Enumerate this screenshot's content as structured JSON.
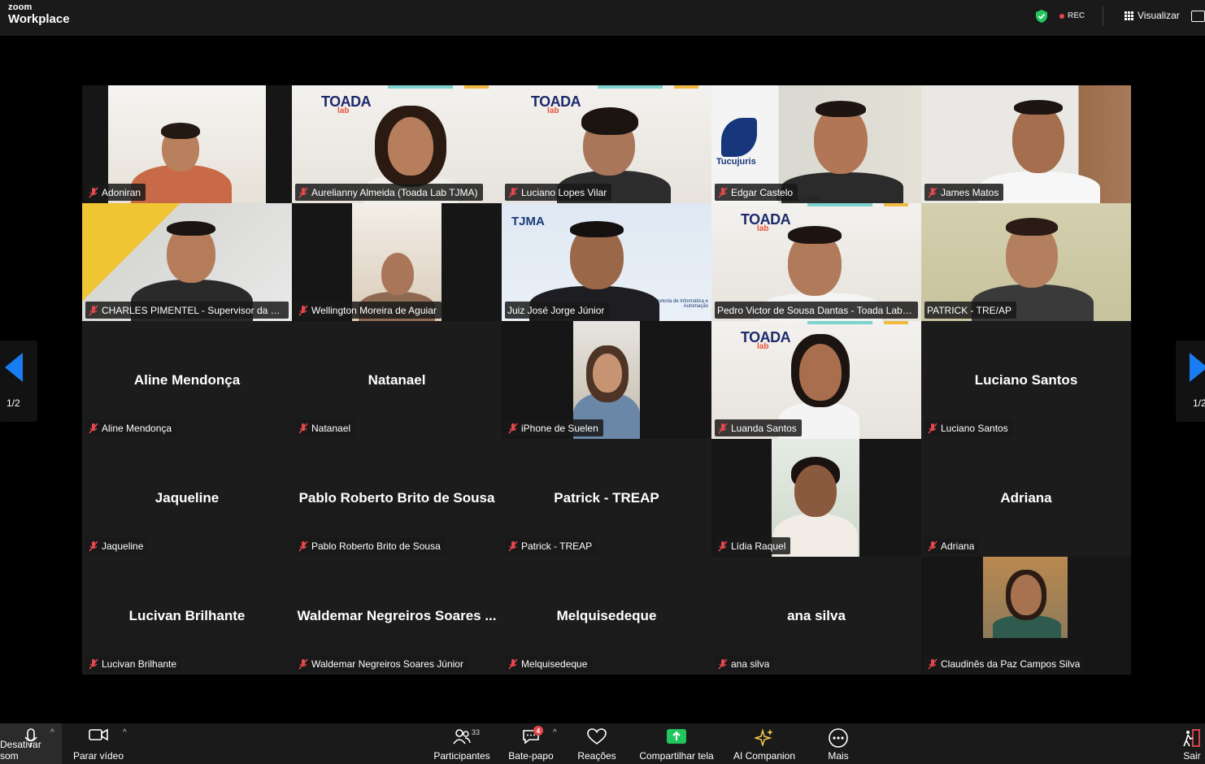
{
  "app": {
    "brand_top": "zoom",
    "brand_bottom": "Workplace"
  },
  "header": {
    "rec_label": "REC",
    "view_label": "Visualizar"
  },
  "pagination": {
    "left": "1/2",
    "right": "1/2"
  },
  "participants": [
    {
      "name": "Adoniran",
      "video": true
    },
    {
      "name": "Aurelianny Almeida (Toada Lab TJMA)",
      "video": true
    },
    {
      "name": "Luciano Lopes Vilar",
      "video": true
    },
    {
      "name": "Edgar Castelo",
      "video": true
    },
    {
      "name": "James Matos",
      "video": true
    },
    {
      "name": "CHARLES PIMENTEL - Supervisor da Cent...",
      "video": true
    },
    {
      "name": "Wellington Moreira de Aguiar",
      "video": true
    },
    {
      "name": "Juiz José Jorge Júnior",
      "video": true
    },
    {
      "name": "Pedro Victor de Sousa Dantas - Toada Lab TJ...",
      "video": true
    },
    {
      "name": "PATRICK - TRE/AP",
      "video": true
    },
    {
      "name": "Aline Mendonça",
      "display": "Aline Mendonça",
      "video": false
    },
    {
      "name": "Natanael",
      "display": "Natanael",
      "video": false
    },
    {
      "name": "iPhone de Suelen",
      "video": true
    },
    {
      "name": "Luanda Santos",
      "video": true
    },
    {
      "name": "Luciano Santos",
      "display": "Luciano Santos",
      "video": false
    },
    {
      "name": "Jaqueline",
      "display": "Jaqueline",
      "video": false
    },
    {
      "name": "Pablo Roberto Brito de Sousa",
      "display": "Pablo Roberto Brito de Sousa",
      "video": false
    },
    {
      "name": "Patrick - TREAP",
      "display": "Patrick - TREAP",
      "video": false
    },
    {
      "name": "Lídia Raquel",
      "video": true
    },
    {
      "name": "Adriana",
      "display": "Adriana",
      "video": false
    },
    {
      "name": "Lucivan Brilhante",
      "display": "Lucivan Brilhante",
      "video": false
    },
    {
      "name": "Waldemar Negreiros Soares Júnior",
      "display": "Waldemar Negreiros Soares ...",
      "video": false
    },
    {
      "name": "Melquisedeque",
      "display": "Melquisedeque",
      "video": false
    },
    {
      "name": "ana silva",
      "display": "ana silva",
      "video": false
    },
    {
      "name": "Claudinês da Paz Campos Silva",
      "video": true
    }
  ],
  "tile_text": {
    "toada": "TOADA",
    "lab": "lab",
    "tucujuris": "Tucujuris",
    "edgar_caption": "Edgar Castelo",
    "tjma": "TJMA",
    "tjma_caption": "Diretoria de Informática e Automação"
  },
  "toolbar": {
    "mute": "Desativar som",
    "video": "Parar vídeo",
    "participants": "Participantes",
    "participants_count": "33",
    "chat": "Bate-papo",
    "chat_badge": "4",
    "reactions": "Reações",
    "share": "Compartilhar tela",
    "ai": "AI Companion",
    "more": "Mais",
    "leave": "Sair"
  },
  "colors": {
    "accent_blue": "#1a7cf2",
    "rec_red": "#e5484d",
    "share_green": "#22c55e",
    "active_speaker": "#c9d36b"
  },
  "icons": [
    "shield-check-icon",
    "grid-icon",
    "screen-icon",
    "mic-muted-icon",
    "chevron-left-icon",
    "chevron-right-icon",
    "microphone-icon",
    "video-camera-icon",
    "participants-icon",
    "chat-icon",
    "heart-icon",
    "share-screen-icon",
    "sparkle-icon",
    "more-icon",
    "leave-icon"
  ]
}
